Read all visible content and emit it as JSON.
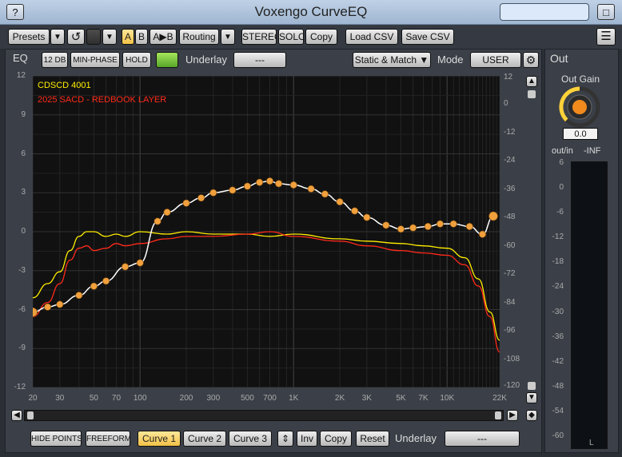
{
  "window": {
    "title": "Voxengo CurveEQ",
    "help_label": "?",
    "minimize_label": "□"
  },
  "toolbar": {
    "presets": "Presets",
    "dropdown": "▼",
    "undo": "↺",
    "a": "A",
    "b": "B",
    "ab": "A▶B",
    "routing": "Routing",
    "stereo": "STEREO",
    "solo": "SOLO",
    "copy": "Copy",
    "load_csv": "Load CSV",
    "save_csv": "Save CSV",
    "menu": "☰"
  },
  "eq": {
    "tab": "EQ",
    "range": "12 DB",
    "phase": "MIN-PHASE",
    "hold": "HOLD",
    "underlay_label": "Underlay",
    "underlay_value": "---",
    "match_mode": "Static & Match ▼",
    "mode_label": "Mode",
    "mode_value": "USER"
  },
  "legend": [
    {
      "name": "CDSCD 4001",
      "color": "#ffee00"
    },
    {
      "name": "2025 SACD - REDBOOK LAYER",
      "color": "#ff2a1a"
    }
  ],
  "axes": {
    "left_ticks": [
      "12",
      "9",
      "6",
      "3",
      "0",
      "-3",
      "-6",
      "-9",
      "-12"
    ],
    "right_ticks": [
      "12",
      "0",
      "-12",
      "-24",
      "-36",
      "-48",
      "-60",
      "-72",
      "-84",
      "-96",
      "-108",
      "-120"
    ],
    "x_ticks": [
      "20",
      "30",
      "50",
      "70",
      "100",
      "200",
      "300",
      "500",
      "700",
      "1K",
      "2K",
      "3K",
      "5K",
      "7K",
      "10K",
      "22K"
    ]
  },
  "chart_data": {
    "type": "line",
    "x_unit": "Hz",
    "left_ylim": [
      -12,
      12
    ],
    "right_ylim": [
      -120,
      12
    ],
    "grid": true,
    "series": [
      {
        "name": "CDSCD 4001",
        "color": "#ffee00",
        "axis": "right",
        "x": [
          20,
          25,
          30,
          35,
          40,
          45,
          50,
          60,
          70,
          80,
          100,
          150,
          200,
          300,
          500,
          700,
          1000,
          2000,
          3000,
          5000,
          7000,
          10000,
          13000,
          16000,
          19000,
          22000
        ],
        "y": [
          -82,
          -76,
          -71,
          -62,
          -56,
          -54,
          -54,
          -56,
          -55,
          -56,
          -54,
          -55,
          -54,
          -55,
          -55,
          -56,
          -55,
          -57,
          -58,
          -59,
          -60,
          -61,
          -65,
          -74,
          -88,
          -100
        ]
      },
      {
        "name": "2025 SACD - REDBOOK LAYER",
        "color": "#ff2a1a",
        "axis": "right",
        "x": [
          20,
          25,
          30,
          35,
          40,
          45,
          50,
          60,
          70,
          80,
          100,
          150,
          200,
          300,
          500,
          700,
          1000,
          2000,
          3000,
          5000,
          7000,
          10000,
          13000,
          16000,
          19000,
          22000
        ],
        "y": [
          -90,
          -84,
          -76,
          -66,
          -61,
          -60,
          -62,
          -61,
          -59,
          -60,
          -59,
          -57,
          -56,
          -56,
          -55,
          -54,
          -56,
          -58,
          -60,
          -62,
          -63,
          -64,
          -68,
          -77,
          -90,
          -105
        ]
      },
      {
        "name": "",
        "color": "#ffffff",
        "point_color": "#f0a03c",
        "axis": "left",
        "x": [
          20,
          25,
          30,
          40,
          50,
          60,
          80,
          100,
          130,
          150,
          200,
          250,
          300,
          400,
          500,
          600,
          700,
          800,
          1000,
          1300,
          1600,
          2000,
          2500,
          3000,
          4000,
          5000,
          6000,
          7500,
          9000,
          11000,
          14000,
          17000,
          20000
        ],
        "y": [
          -6.2,
          -5.8,
          -5.6,
          -4.9,
          -4.2,
          -3.8,
          -2.7,
          -2.4,
          0.8,
          1.5,
          2.2,
          2.6,
          3.0,
          3.2,
          3.5,
          3.8,
          3.9,
          3.7,
          3.6,
          3.3,
          2.9,
          2.3,
          1.6,
          1.1,
          0.5,
          0.2,
          0.3,
          0.4,
          0.6,
          0.6,
          0.4,
          -0.2,
          1.2
        ]
      }
    ]
  },
  "out": {
    "tab": "Out",
    "gain_label": "Out Gain",
    "gain_value": "0.0",
    "gain_level": 0.5,
    "outin_label": "out/in",
    "peak": "-INF",
    "scale": [
      "6",
      "0",
      "-6",
      "-12",
      "-18",
      "-24",
      "-30",
      "-36",
      "-42",
      "-48",
      "-54",
      "-60"
    ],
    "channel": "L"
  },
  "bottom": {
    "hide_points": "HIDE POINTS",
    "freeform": "FREEFORM",
    "curve1": "Curve 1",
    "curve2": "Curve 2",
    "curve3": "Curve 3",
    "updown": "⇕",
    "inv": "Inv",
    "copy": "Copy",
    "reset": "Reset",
    "underlay_label": "Underlay",
    "underlay_value": "---"
  },
  "scroll": {
    "up": "▲",
    "down": "▼",
    "left": "◀",
    "right": "▶",
    "diamond": "◆"
  }
}
